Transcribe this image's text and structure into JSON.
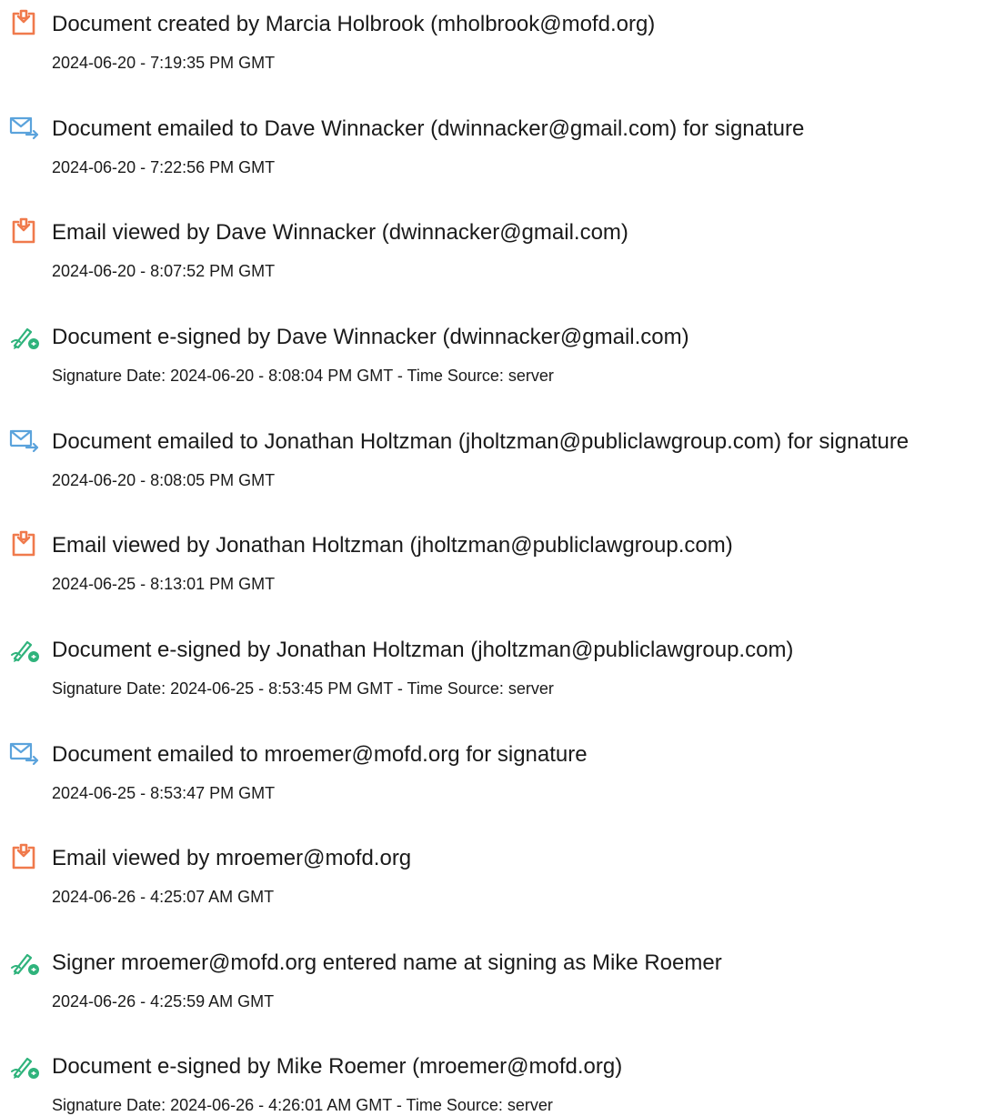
{
  "colors": {
    "doc_icon": "#f07a4c",
    "email_icon": "#5ba3dc",
    "sign_icon": "#2fb37c",
    "text": "#1a1a1a"
  },
  "events": [
    {
      "icon": "document-icon",
      "title": "Document created by Marcia Holbrook (mholbrook@mofd.org)",
      "time": "2024-06-20 - 7:19:35 PM GMT"
    },
    {
      "icon": "email-icon",
      "title": "Document emailed to Dave Winnacker (dwinnacker@gmail.com) for signature",
      "time": "2024-06-20 - 7:22:56 PM GMT"
    },
    {
      "icon": "document-icon",
      "title": "Email viewed by Dave Winnacker (dwinnacker@gmail.com)",
      "time": "2024-06-20 - 8:07:52 PM GMT"
    },
    {
      "icon": "esign-icon",
      "title": "Document e-signed by Dave Winnacker (dwinnacker@gmail.com)",
      "time": "Signature Date: 2024-06-20 - 8:08:04 PM GMT - Time Source: server"
    },
    {
      "icon": "email-icon",
      "title": "Document emailed to Jonathan Holtzman (jholtzman@publiclawgroup.com) for signature",
      "time": "2024-06-20 - 8:08:05 PM GMT"
    },
    {
      "icon": "document-icon",
      "title": "Email viewed by Jonathan Holtzman (jholtzman@publiclawgroup.com)",
      "time": "2024-06-25 - 8:13:01 PM GMT"
    },
    {
      "icon": "esign-icon",
      "title": "Document e-signed by Jonathan Holtzman (jholtzman@publiclawgroup.com)",
      "time": "Signature Date: 2024-06-25 - 8:53:45 PM GMT - Time Source: server"
    },
    {
      "icon": "email-icon",
      "title": "Document emailed to mroemer@mofd.org for signature",
      "time": "2024-06-25 - 8:53:47 PM GMT"
    },
    {
      "icon": "document-icon",
      "title": "Email viewed by mroemer@mofd.org",
      "time": "2024-06-26 - 4:25:07 AM GMT"
    },
    {
      "icon": "esign-icon",
      "title": "Signer mroemer@mofd.org entered name at signing as Mike Roemer",
      "time": "2024-06-26 - 4:25:59 AM GMT"
    },
    {
      "icon": "esign-icon",
      "title": "Document e-signed by Mike Roemer (mroemer@mofd.org)",
      "time": "Signature Date: 2024-06-26 - 4:26:01 AM GMT - Time Source: server"
    }
  ]
}
